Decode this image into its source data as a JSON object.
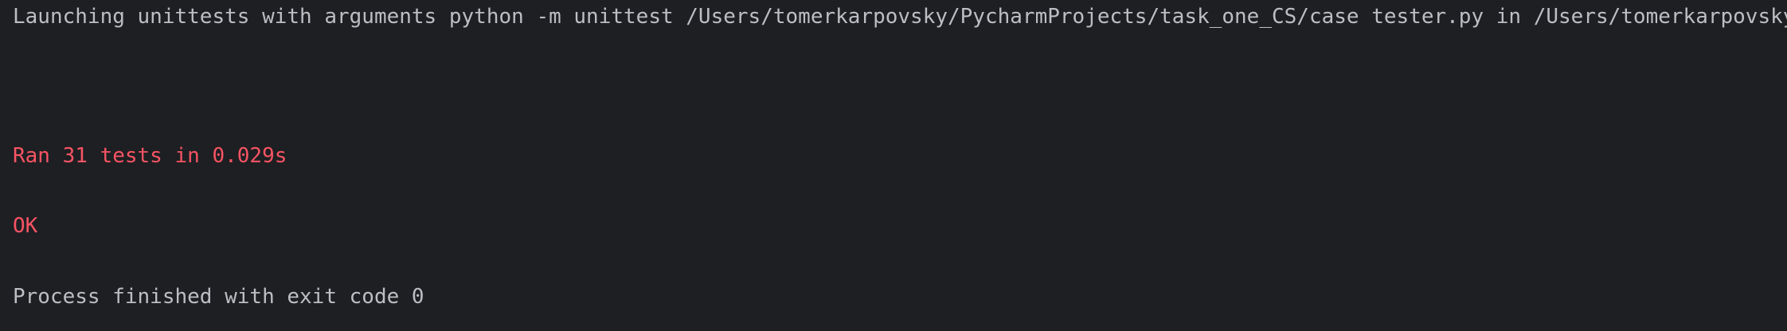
{
  "console": {
    "lines": [
      {
        "text": "Launching unittests with arguments python -m unittest /Users/tomerkarpovsky/PycharmProjects/task_one_CS/case tester.py in /Users/tomerkarpovsky",
        "color": "#bcbec4"
      },
      {
        "text": "Ran 31 tests in 0.029s",
        "color": "#f75464"
      },
      {
        "text": "OK",
        "color": "#f75464"
      },
      {
        "text": "Process finished with exit code 0",
        "color": "#bcbec4"
      }
    ]
  },
  "colors": {
    "background": "#1e1f22",
    "stdout_text": "#bcbec4",
    "stderr_text": "#f75464"
  }
}
